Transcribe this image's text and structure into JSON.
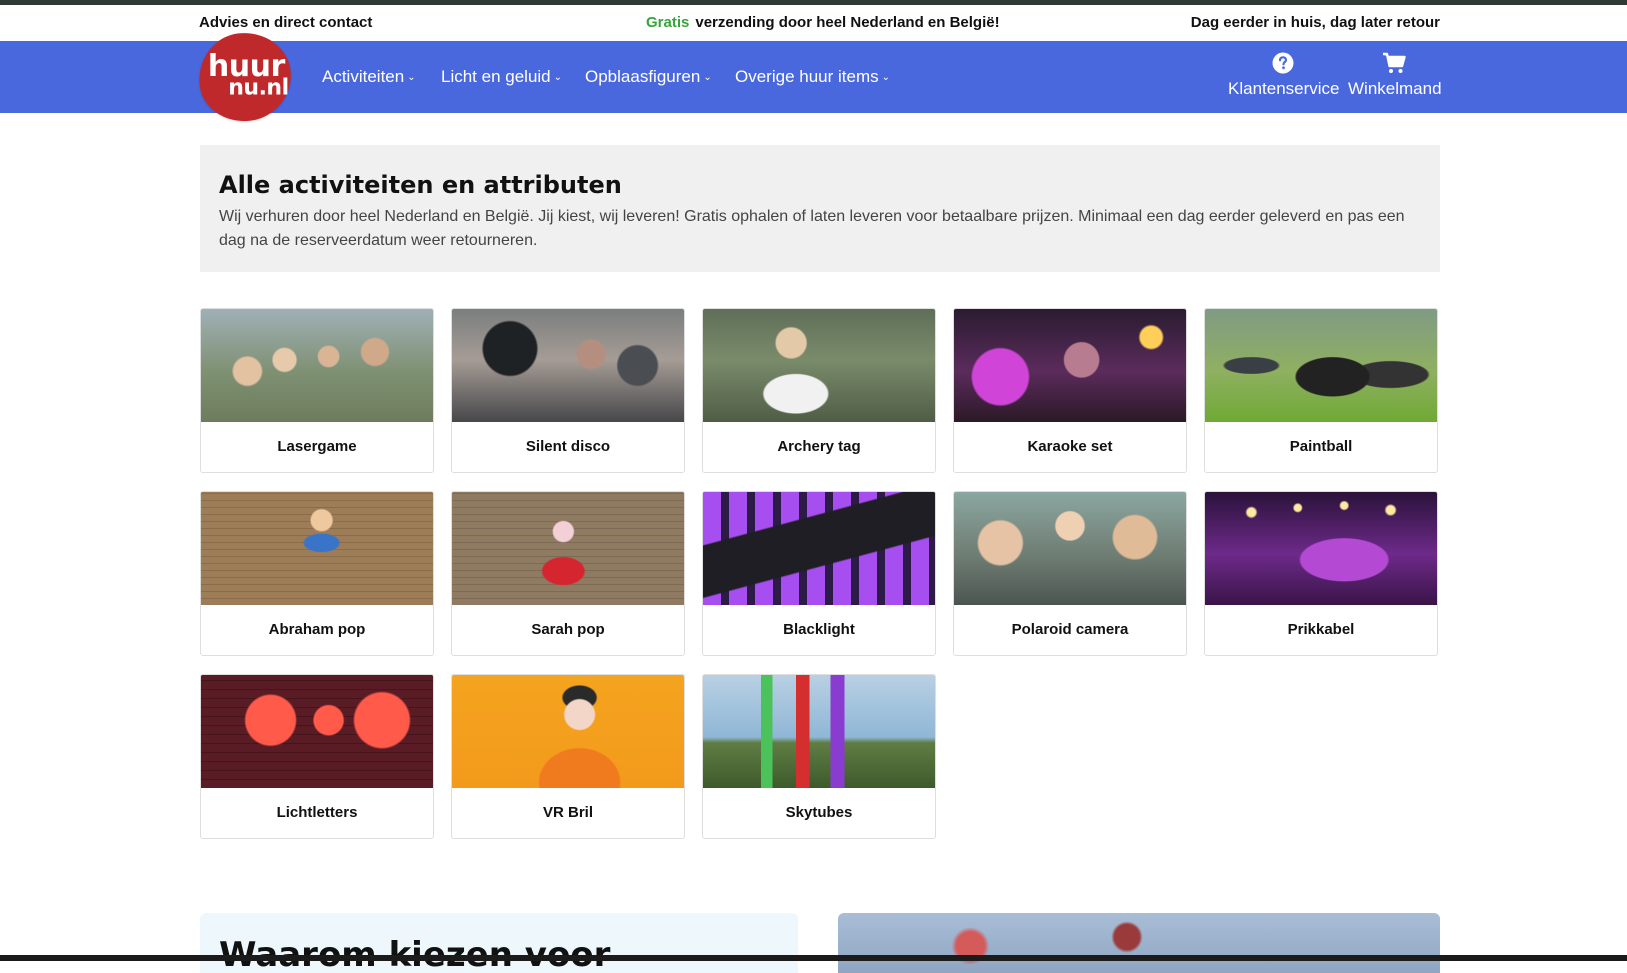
{
  "usp": {
    "left": "Advies en direct contact",
    "center_highlight": "Gratis",
    "center_text": "verzending door heel Nederland en België!",
    "right": "Dag eerder in huis, dag later retour"
  },
  "logo": {
    "line1": "huur",
    "line2": "nu.nl"
  },
  "nav": {
    "items": [
      {
        "label": "Activiteiten"
      },
      {
        "label": "Licht en geluid"
      },
      {
        "label": "Opblaasfiguren"
      },
      {
        "label": "Overige huur items"
      }
    ],
    "klantenservice": "Klantenservice",
    "winkelmand": "Winkelmand"
  },
  "intro": {
    "title": "Alle activiteiten en attributen",
    "text": "Wij verhuren door heel Nederland en België. Jij kiest, wij leveren! Gratis ophalen of laten leveren voor betaalbare prijzen. Minimaal een dag eerder geleverd en pas een dag na de reserveerdatum weer retourneren."
  },
  "products": [
    {
      "label": "Lasergame"
    },
    {
      "label": "Silent disco"
    },
    {
      "label": "Archery tag"
    },
    {
      "label": "Karaoke set"
    },
    {
      "label": "Paintball"
    },
    {
      "label": "Abraham pop"
    },
    {
      "label": "Sarah pop"
    },
    {
      "label": "Blacklight"
    },
    {
      "label": "Polaroid camera"
    },
    {
      "label": "Prikkabel"
    },
    {
      "label": "Lichtletters"
    },
    {
      "label": "VR Bril"
    },
    {
      "label": "Skytubes"
    }
  ],
  "why": {
    "title": "Waarom kiezen voor"
  },
  "colors": {
    "nav_bg": "#4a68de",
    "logo_bg": "#c0292b",
    "gratis_green": "#36a53b",
    "intro_bg": "#f0f0f0"
  },
  "icons": {
    "klantenservice": "question-circle-icon",
    "winkelmand": "shopping-cart-icon",
    "dropdown": "chevron-down-icon"
  }
}
